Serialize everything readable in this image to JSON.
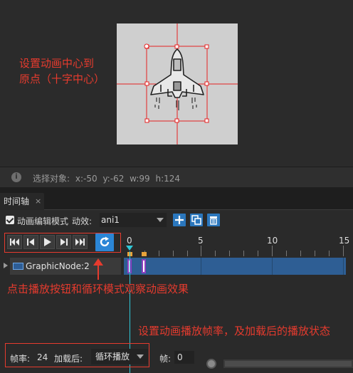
{
  "scene": {
    "annotation": "设置动画中心到\n原点（十字中心）"
  },
  "status": {
    "info_icon": "i",
    "prefix": "选择对象:",
    "x": "x:-50",
    "y": "y:-62",
    "w": "w:99",
    "h": "h:124"
  },
  "tabs": [
    {
      "label": "时间轴",
      "close": "×"
    }
  ],
  "toolbar": {
    "edit_mode_label": "动画编辑模式",
    "effect_label": "动效:",
    "effect_value": "ani1",
    "buttons": [
      "add-icon",
      "copy-icon",
      "delete-icon"
    ]
  },
  "transport": {
    "buttons": [
      "first-frame-icon",
      "prev-frame-icon",
      "play-icon",
      "next-frame-icon",
      "last-frame-icon"
    ],
    "loop_icon": "loop-icon"
  },
  "ruler": {
    "labels": [
      "0",
      "5",
      "10",
      "15"
    ]
  },
  "track": {
    "name": "GraphicNode:2",
    "keyframes": [
      0,
      2
    ]
  },
  "annotations": {
    "play_hint": "点击播放按钮和循环模式观察动画效果",
    "rate_hint": "设置动画播放帧率，及加载后的播放状态"
  },
  "footer": {
    "rate_label": "帧率:",
    "rate_value": "24",
    "after_load_label": "加载后:",
    "after_load_value": "循环播放",
    "frame_label": "帧:",
    "frame_value": "0"
  },
  "colors": {
    "accent": "#2b86d6",
    "annotation_red": "#e63b2e",
    "track_blue": "#2e5e94",
    "playhead": "#2fc8d8",
    "keyframe": "#e8a23a"
  }
}
